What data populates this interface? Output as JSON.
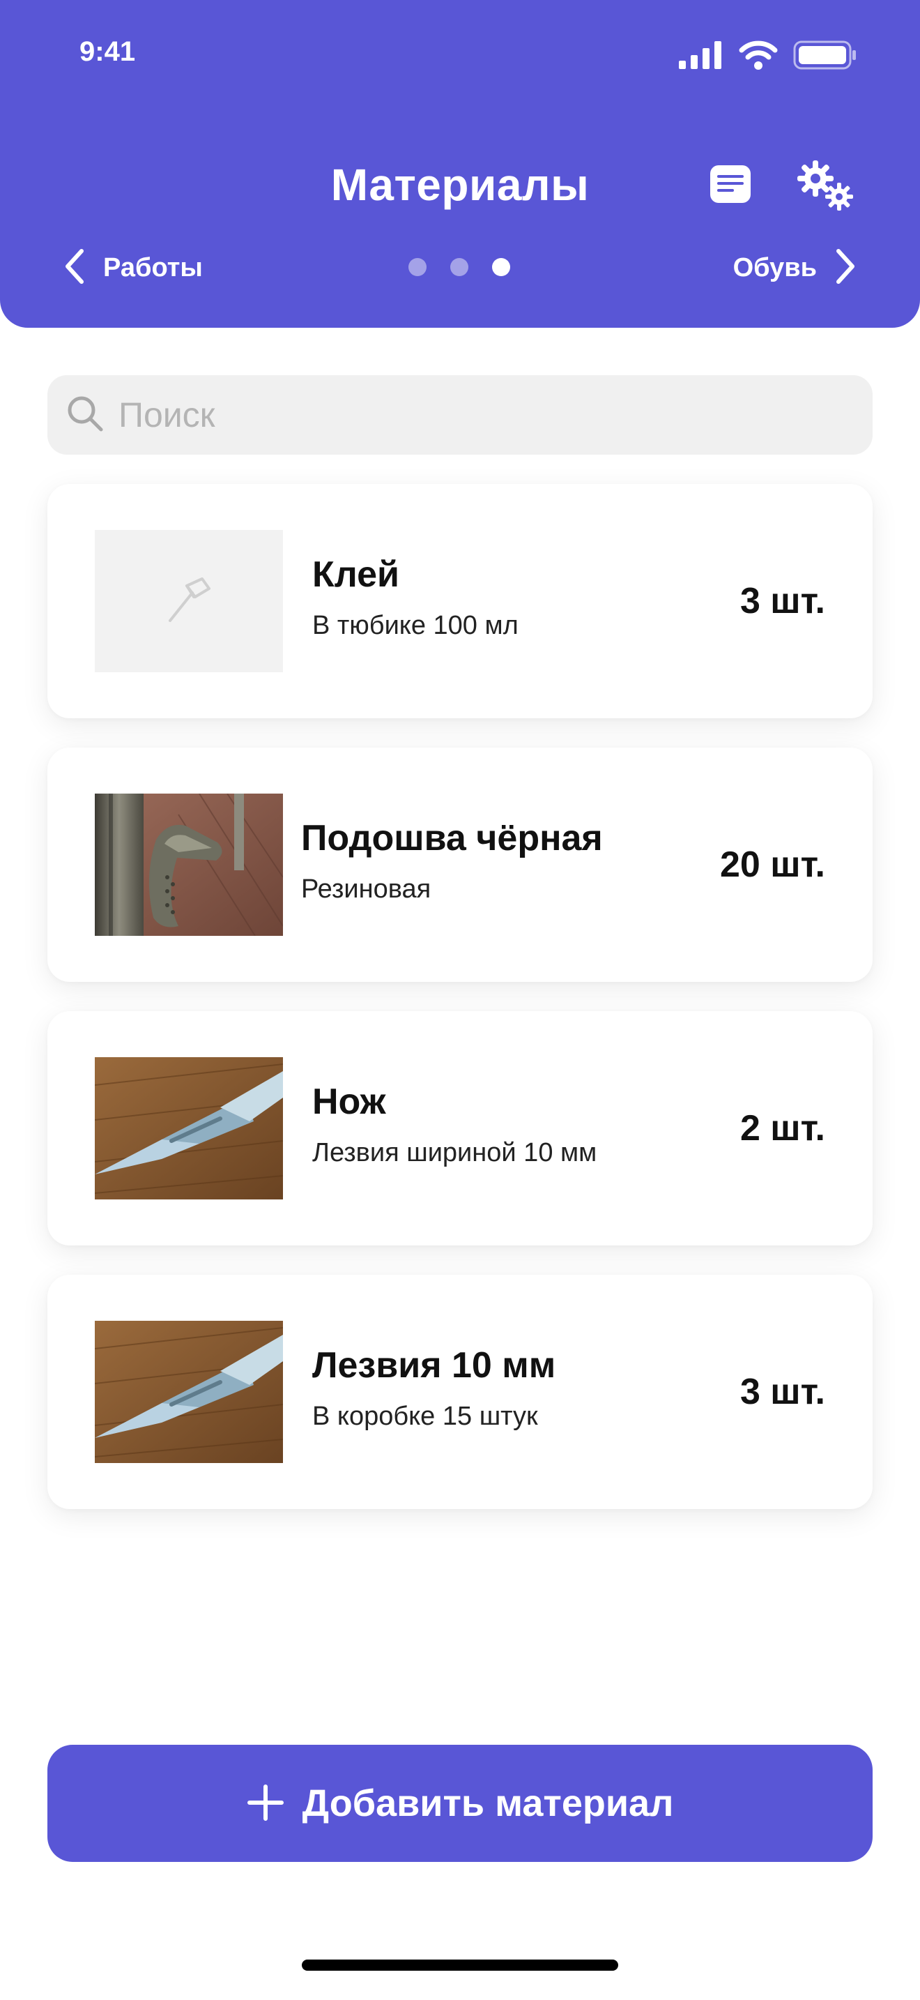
{
  "status_bar": {
    "time": "9:41",
    "icons": [
      "signal-icon",
      "wifi-icon",
      "battery-icon"
    ]
  },
  "header": {
    "title": "Материалы",
    "icons": [
      "document-list-icon",
      "settings-gears-icon"
    ],
    "prev_label": "Работы",
    "next_label": "Обувь",
    "page_dots": {
      "count": 3,
      "active": 3
    }
  },
  "search": {
    "placeholder": "Поиск",
    "value": ""
  },
  "materials": [
    {
      "title": "Клей",
      "subtitle": "В тюбике 100 мл",
      "qty": "3 шт.",
      "image": "hammer-placeholder-icon"
    },
    {
      "title": "Подошва чёрная",
      "subtitle": "Резиновая",
      "qty": "20 шт.",
      "image": "sole-photo"
    },
    {
      "title": "Нож",
      "subtitle": "Лезвия шириной 10 мм",
      "qty": "2 шт.",
      "image": "scalpel-photo"
    },
    {
      "title": "Лезвия 10 мм",
      "subtitle": "В коробке 15 штук",
      "qty": "3 шт.",
      "image": "scalpel-photo"
    }
  ],
  "add_button": {
    "label": "Добавить материал",
    "icon": "plus-icon"
  },
  "colors": {
    "accent": "#5956D6",
    "search_bg": "#F0F0F0",
    "placeholder": "#B4B4B4"
  }
}
